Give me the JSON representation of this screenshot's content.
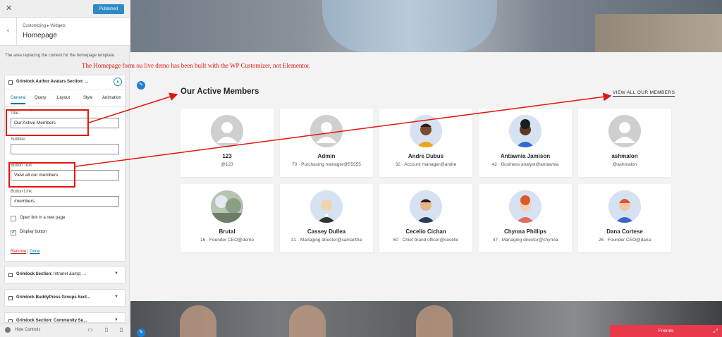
{
  "sidebar": {
    "close_label": "✕",
    "publish_label": "Published",
    "breadcrumb": "Customizing ▸ Widgets",
    "title": "Homepage",
    "description": "The area replacing the content for the homepage template.",
    "widget": {
      "title": "Grimlock Author Avatars Section: ...",
      "toggle": "▲",
      "tabs": [
        "General",
        "Query",
        "Layout",
        "Style",
        "Animation"
      ],
      "fields": {
        "title_label": "Title:",
        "title_value": "Our Active Members",
        "subtitle_label": "Subtitle:",
        "subtitle_value": "",
        "button_text_label": "Button Text:",
        "button_text_value": "View all our members",
        "button_link_label": "Button Link:",
        "button_link_value": "/members",
        "open_new_page_label": "Open link in a new page",
        "open_new_page_checked": false,
        "display_button_label": "Display button",
        "display_button_checked": true
      },
      "remove_label": "Remove",
      "separator": "|",
      "done_label": "Done"
    },
    "sections": [
      {
        "prefix": "Grimlock Section:",
        "rest": " Intranet &amp; ...",
        "arrow": "▼"
      },
      {
        "prefix": "Grimlock BuddyPress Groups Sect...",
        "rest": "",
        "arrow": "▼"
      },
      {
        "prefix": "Grimlock Section: Community Su...",
        "rest": "",
        "arrow": "▼"
      }
    ],
    "footer": {
      "hide_label": "Hide Controls"
    }
  },
  "preview": {
    "annotation": "The Homepage form ou live demo has been built with the WP Customizer, not Elementor.",
    "section_title": "Our Active Members",
    "view_all_label": "VIEW ALL OUR MEMBERS",
    "members": [
      {
        "name": "123",
        "meta": "@123",
        "avatar": "default"
      },
      {
        "name": "Admin",
        "meta": "70 · Purchasing manager@55555",
        "avatar": "default"
      },
      {
        "name": "Andre Dubus",
        "meta": "32 · Account manager@andre",
        "avatar": "man-dark"
      },
      {
        "name": "Antawnia Jamison",
        "meta": "42 · Business analyst@antawnia",
        "avatar": "woman-dark"
      },
      {
        "name": "ashmalon",
        "meta": "@ashmalon",
        "avatar": "default"
      },
      {
        "name": "Brutal",
        "meta": "16 · Founder CEO@demo",
        "avatar": "photo"
      },
      {
        "name": "Cassey Dullea",
        "meta": "31 · Managing director@samantha",
        "avatar": "man-bald"
      },
      {
        "name": "Cecelio Cichan",
        "meta": "60 · Chief brand officer@cecelio",
        "avatar": "man-suit"
      },
      {
        "name": "Chynna Phillips",
        "meta": "47 · Managing director@chynna",
        "avatar": "woman-red"
      },
      {
        "name": "Dana Cortese",
        "meta": "26 · Founder CEO@dana",
        "avatar": "woman-headset"
      }
    ],
    "friends_label": "Friends",
    "friends_arrow": "⤢"
  },
  "colors": {
    "accent": "#2d8ac7",
    "annotation": "#e2160f",
    "friends": "#e8394d"
  }
}
